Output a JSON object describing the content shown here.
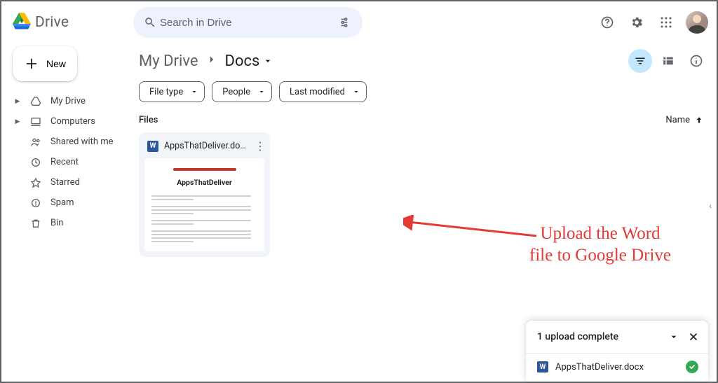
{
  "header": {
    "product": "Drive",
    "search_placeholder": "Search in Drive"
  },
  "sidebar": {
    "new_label": "New",
    "items": [
      {
        "label": "My Drive",
        "icon": "drive"
      },
      {
        "label": "Computers",
        "icon": "computer"
      },
      {
        "label": "Shared with me",
        "icon": "people"
      },
      {
        "label": "Recent",
        "icon": "clock"
      },
      {
        "label": "Starred",
        "icon": "star"
      },
      {
        "label": "Spam",
        "icon": "spam"
      },
      {
        "label": "Bin",
        "icon": "trash"
      }
    ]
  },
  "breadcrumb": {
    "root": "My Drive",
    "current": "Docs"
  },
  "filters": [
    {
      "label": "File type"
    },
    {
      "label": "People"
    },
    {
      "label": "Last modified"
    }
  ],
  "main": {
    "section_label": "Files",
    "sort_label": "Name"
  },
  "files": [
    {
      "name": "AppsThatDeliver.docx",
      "type": "docx",
      "preview_title": "AppsThatDeliver",
      "badge": "W"
    }
  ],
  "upload": {
    "title": "1 upload complete",
    "items": [
      {
        "name": "AppsThatDeliver.docx",
        "status": "complete",
        "badge": "W"
      }
    ]
  },
  "annotation": {
    "text": "Upload the Word\nfile to Google Drive"
  },
  "colors": {
    "accent": "#1a73e8",
    "annotation": "#e53935",
    "success": "#34a853",
    "word": "#2b579a"
  }
}
